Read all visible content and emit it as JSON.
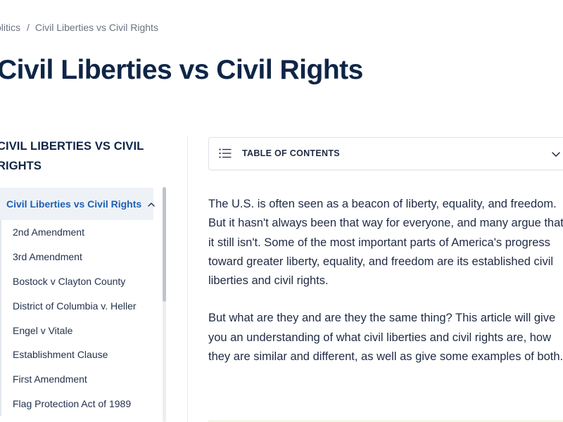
{
  "breadcrumb": {
    "parent": "olitics",
    "separator": "/",
    "current": "Civil Liberties vs Civil Rights"
  },
  "page": {
    "title": "Civil Liberties vs Civil Rights"
  },
  "sidebar": {
    "heading_line1": "CIVIL LIBERTIES VS CIVIL",
    "heading_line2": "RIGHTS",
    "active_item": "Civil Liberties vs Civil Rights",
    "items": [
      {
        "label": "2nd Amendment"
      },
      {
        "label": "3rd Amendment"
      },
      {
        "label": "Bostock v Clayton County"
      },
      {
        "label": "District of Columbia v. Heller"
      },
      {
        "label": "Engel v Vitale"
      },
      {
        "label": "Establishment Clause"
      },
      {
        "label": "First Amendment"
      },
      {
        "label": "Flag Protection Act of 1989"
      }
    ]
  },
  "toc": {
    "label": "TABLE OF CONTENTS",
    "icon": "list-icon",
    "expand_icon": "chevron-down-icon"
  },
  "article": {
    "paragraph1": [
      "The U.S. is often seen as a beacon of liberty, equality, and freedom.",
      "But it hasn't always been that way for everyone, and many argue that",
      "it still isn't. Some of the most important parts of America's progress",
      "toward greater liberty, equality, and freedom are its established civil",
      "liberties and civil rights."
    ],
    "paragraph2": [
      "But what are they and are they the same thing? This article will give",
      "you an understanding of what civil liberties and civil rights are, how",
      "they are similar and different, as well as give some examples of both."
    ]
  },
  "colors": {
    "title": "#0f2547",
    "active_link": "#1d5fb5",
    "active_bg": "#eef2f7",
    "body_text": "#1f2a44"
  }
}
